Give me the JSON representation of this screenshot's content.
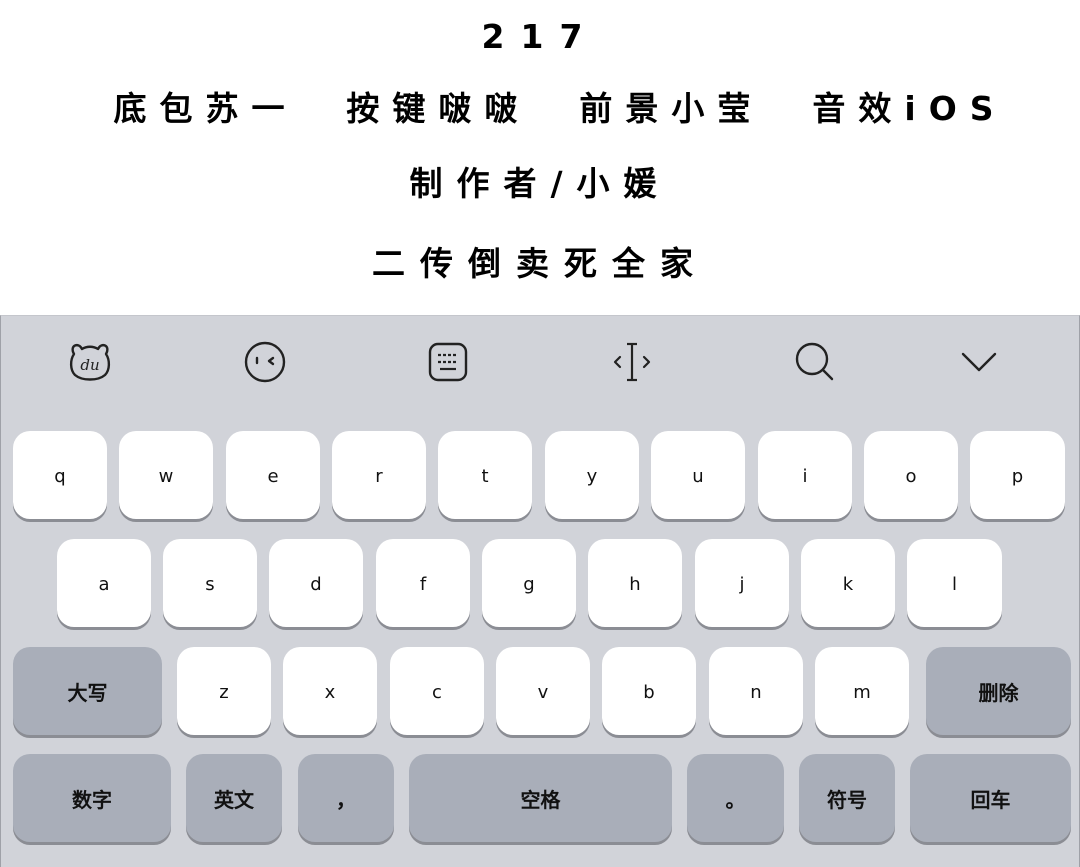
{
  "header": {
    "number": "217",
    "credits": "底包苏一  按键啵啵  前景小莹  音效iOS",
    "author": "制作者/小媛",
    "warning": "二传倒卖死全家"
  },
  "toolbar": {
    "icons": [
      "baidu-bear-icon",
      "emoji-face-icon",
      "keyboard-layout-icon",
      "cursor-move-icon",
      "search-icon",
      "collapse-chevron-icon"
    ],
    "bear_text": "du"
  },
  "keys": {
    "row1": [
      "q",
      "w",
      "e",
      "r",
      "t",
      "y",
      "u",
      "i",
      "o",
      "p"
    ],
    "row2": [
      "a",
      "s",
      "d",
      "f",
      "g",
      "h",
      "j",
      "k",
      "l"
    ],
    "row3": [
      "z",
      "x",
      "c",
      "v",
      "b",
      "n",
      "m"
    ],
    "shift": "大写",
    "delete": "删除",
    "numbers": "数字",
    "english": "英文",
    "comma": "，",
    "space": "空格",
    "period": "。",
    "symbols": "符号",
    "enter": "回车"
  },
  "colors": {
    "keyboard_bg": "#d1d3d9",
    "key_bg": "#ffffff",
    "func_key_bg": "#a9aeb9"
  }
}
